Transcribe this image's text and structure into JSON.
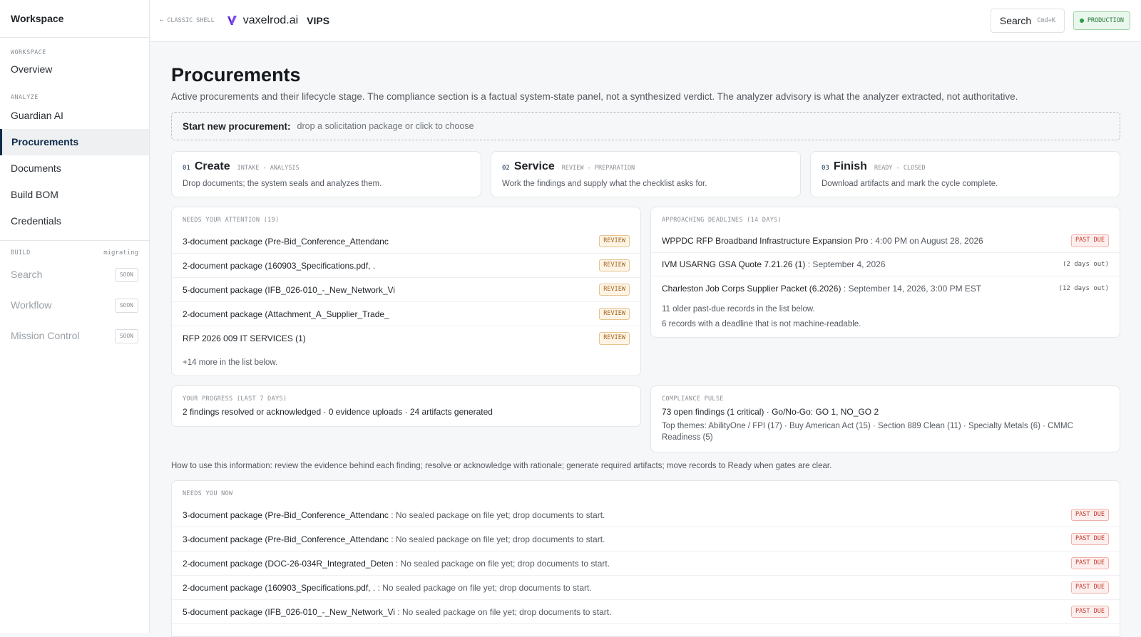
{
  "sidebar": {
    "header": "Workspace",
    "sections": [
      {
        "label": "WORKSPACE",
        "items": [
          {
            "label": "Overview"
          }
        ]
      },
      {
        "label": "ANALYZE",
        "items": [
          {
            "label": "Guardian AI"
          },
          {
            "label": "Procurements",
            "active": true
          },
          {
            "label": "Documents"
          },
          {
            "label": "Build BOM"
          },
          {
            "label": "Credentials"
          }
        ]
      }
    ],
    "build": {
      "label": "BUILD",
      "status": "migrating",
      "items": [
        {
          "label": "Search",
          "badge": "SOON"
        },
        {
          "label": "Workflow",
          "badge": "SOON"
        },
        {
          "label": "Mission Control",
          "badge": "SOON"
        }
      ]
    }
  },
  "topbar": {
    "classic_link": "← CLASSIC SHELL",
    "logo_text": "vaxelrod.ai",
    "product": "VIPS",
    "search_label": "Search",
    "search_shortcut": "Cmd+K",
    "env_badge": "PRODUCTION",
    "colors": {
      "logo_accent": "#5b2be0",
      "env_green": "#2e9b47"
    }
  },
  "page": {
    "title": "Procurements",
    "subtitle": "Active procurements and their lifecycle stage. The compliance section is a factual system-state panel, not a synthesized verdict. The analyzer advisory is what the analyzer extracted, not authoritative.",
    "dropzone": {
      "label": "Start new procurement:",
      "hint": "drop a solicitation package or click to choose"
    }
  },
  "stages": [
    {
      "num": "01",
      "name": "Create",
      "tag": "INTAKE - ANALYSIS",
      "desc": "Drop documents; the system seals and analyzes them."
    },
    {
      "num": "02",
      "name": "Service",
      "tag": "REVIEW - PREPARATION",
      "desc": "Work the findings and supply what the checklist asks for."
    },
    {
      "num": "03",
      "name": "Finish",
      "tag": "READY - CLOSED",
      "desc": "Download artifacts and mark the cycle complete."
    }
  ],
  "attention": {
    "title": "NEEDS YOUR ATTENTION (19)",
    "rows": [
      {
        "name": "3-document package (Pre-Bid_Conference_Attendanc",
        "badge": "REVIEW"
      },
      {
        "name": "2-document package (160903_Specifications.pdf, .",
        "badge": "REVIEW"
      },
      {
        "name": "5-document package (IFB_026-010_-_New_Network_Vi",
        "badge": "REVIEW"
      },
      {
        "name": "2-document package (Attachment_A_Supplier_Trade_",
        "badge": "REVIEW"
      },
      {
        "name": "RFP 2026 009 IT SERVICES (1)",
        "badge": "REVIEW"
      }
    ],
    "more": "+14 more in the list below."
  },
  "deadlines": {
    "title": "APPROACHING DEADLINES (14 DAYS)",
    "rows": [
      {
        "name": "WPPDC RFP Broadband Infrastructure Expansion Pro",
        "when": ": 4:00 PM on August 28, 2026",
        "status": "PAST DUE"
      },
      {
        "name": "IVM USARNG GSA Quote 7.21.26 (1)",
        "when": ": September 4, 2026",
        "status": "(2 days out)"
      },
      {
        "name": "Charleston Job Corps Supplier Packet (6.2026)",
        "when": ": September 14, 2026, 3:00 PM EST",
        "status": "(12 days out)"
      }
    ],
    "note1": "11 older past-due records in the list below.",
    "note2": "6 records with a deadline that is not machine-readable."
  },
  "progress": {
    "title": "YOUR PROGRESS (LAST 7 DAYS)",
    "line": "2 findings resolved or acknowledged · 0 evidence uploads · 24 artifacts generated"
  },
  "pulse": {
    "title": "COMPLIANCE PULSE",
    "line": "73 open findings (1 critical) · Go/No-Go: GO 1, NO_GO 2",
    "themes": "Top themes: AbilityOne / FPI (17) · Buy American Act (15) · Section 889 Clean (11) · Specialty Metals (6) · CMMC Readiness (5)"
  },
  "howto": "How to use this information: review the evidence behind each finding; resolve or acknowledge with rationale; generate required artifacts; move records to Ready when gates are clear.",
  "needs_now": {
    "title": "NEEDS YOU NOW",
    "rows": [
      {
        "name": "3-document package (Pre-Bid_Conference_Attendanc",
        "msg": ": No sealed package on file yet; drop documents to start.",
        "badge": "PAST DUE"
      },
      {
        "name": "3-document package (Pre-Bid_Conference_Attendanc",
        "msg": ": No sealed package on file yet; drop documents to start.",
        "badge": "PAST DUE"
      },
      {
        "name": "2-document package (DOC-26-034R_Integrated_Deten",
        "msg": ": No sealed package on file yet; drop documents to start.",
        "badge": "PAST DUE"
      },
      {
        "name": "2-document package (160903_Specifications.pdf, .",
        "msg": ": No sealed package on file yet; drop documents to start.",
        "badge": "PAST DUE"
      },
      {
        "name": "5-document package (IFB_026-010_-_New_Network_Vi",
        "msg": ": No sealed package on file yet; drop documents to start.",
        "badge": "PAST DUE"
      }
    ]
  }
}
